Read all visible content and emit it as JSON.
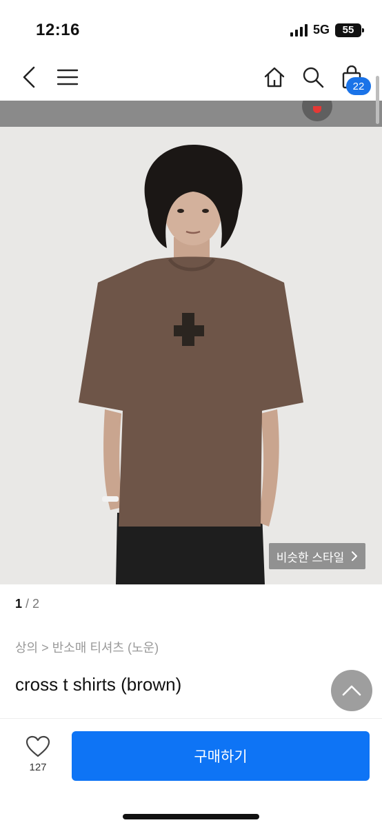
{
  "status": {
    "time": "12:16",
    "network": "5G",
    "battery": "55"
  },
  "nav": {
    "back_icon": "chevron-left-icon",
    "menu_icon": "hamburger-menu-icon",
    "home_icon": "home-icon",
    "search_icon": "search-icon",
    "cart_icon": "shopping-bag-icon",
    "cart_count": "22"
  },
  "product": {
    "similar_style_label": "비슷한 스타일",
    "pager_current": "1",
    "pager_total": "/ 2",
    "breadcrumb": "상의 > 반소매 티셔츠 (노운)",
    "title": "cross t shirts (brown)"
  },
  "actions": {
    "like_count": "127",
    "buy_label": "구매하기"
  },
  "colors": {
    "accent": "#0e74f5",
    "badge": "#1a73e8",
    "shirt": "#6e5548"
  }
}
